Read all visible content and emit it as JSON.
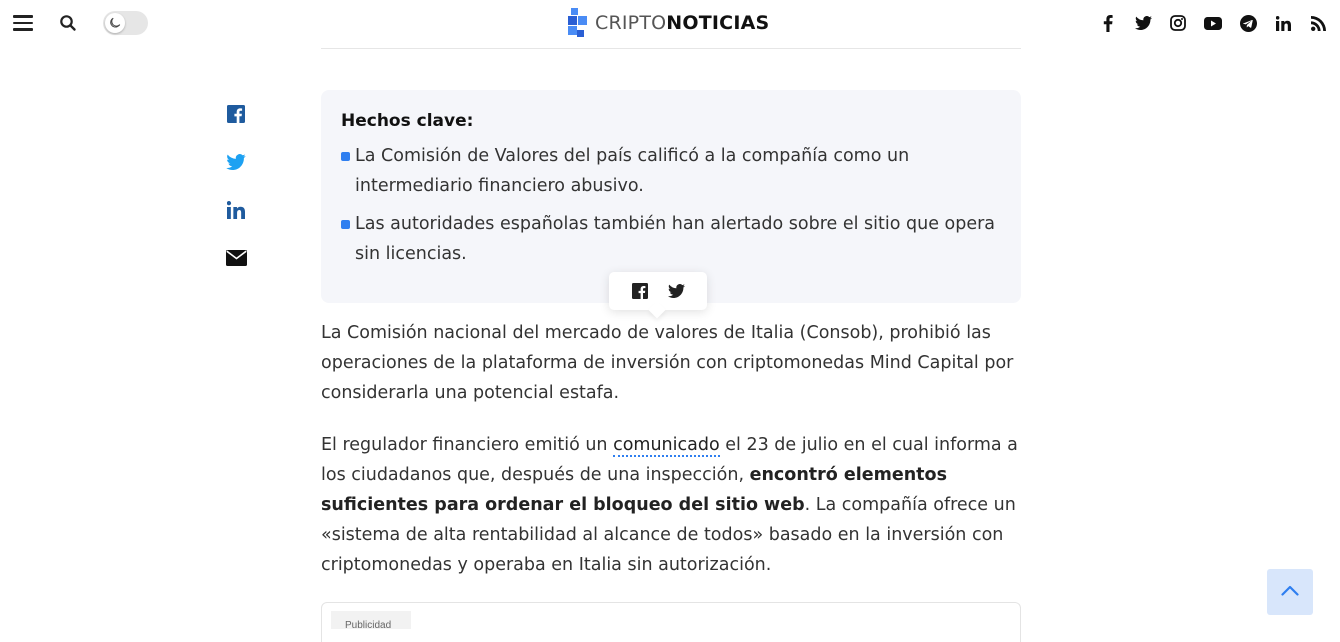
{
  "header": {
    "logo_part1": "CRIPTO",
    "logo_part2": "NOTICIAS",
    "menu_icon": "hamburger-icon",
    "search_icon": "search-icon",
    "theme_toggle_icon": "moon-icon",
    "social_icons": [
      "facebook-icon",
      "twitter-icon",
      "instagram-icon",
      "youtube-icon",
      "telegram-icon",
      "linkedin-icon",
      "rss-icon"
    ]
  },
  "share_sidebar": {
    "icons": [
      "facebook-icon",
      "twitter-icon",
      "linkedin-icon",
      "email-icon"
    ]
  },
  "key_facts": {
    "title": "Hechos clave:",
    "items": [
      "La Comisión de Valores del país calificó a la compañía como un intermediario financiero abusivo.",
      "Las autoridades españolas también han alertado sobre el sitio que opera sin licencias."
    ]
  },
  "share_tooltip": {
    "icons": [
      "facebook-icon",
      "twitter-icon"
    ]
  },
  "article": {
    "p1": "La Comisión nacional del mercado de valores de Italia (Consob), prohibió las operaciones de la plataforma de inversión con criptomonedas Mind Capital por considerarla una potencial estafa.",
    "p2_a": "El regulador financiero emitió un ",
    "p2_link": "comunicado",
    "p2_b": " el 23 de julio en el cual informa a los ciudadanos que, después de una inspección, ",
    "p2_bold": "encontró elementos suficientes para ordenar el bloqueo del sitio web",
    "p2_c": ". La compañía ofrece un «sistema de alta rentabilidad al alcance de todos» basado en la inversión con criptomonedas y operaba en Italia sin autorización."
  },
  "ad": {
    "label": "Publicidad"
  },
  "back_to_top_icon": "chevron-up-icon",
  "colors": {
    "accent": "#2f7ff0",
    "facebook": "#1f5b9e",
    "twitter": "#1da1f2",
    "facts_bg": "#f5f6fa"
  }
}
